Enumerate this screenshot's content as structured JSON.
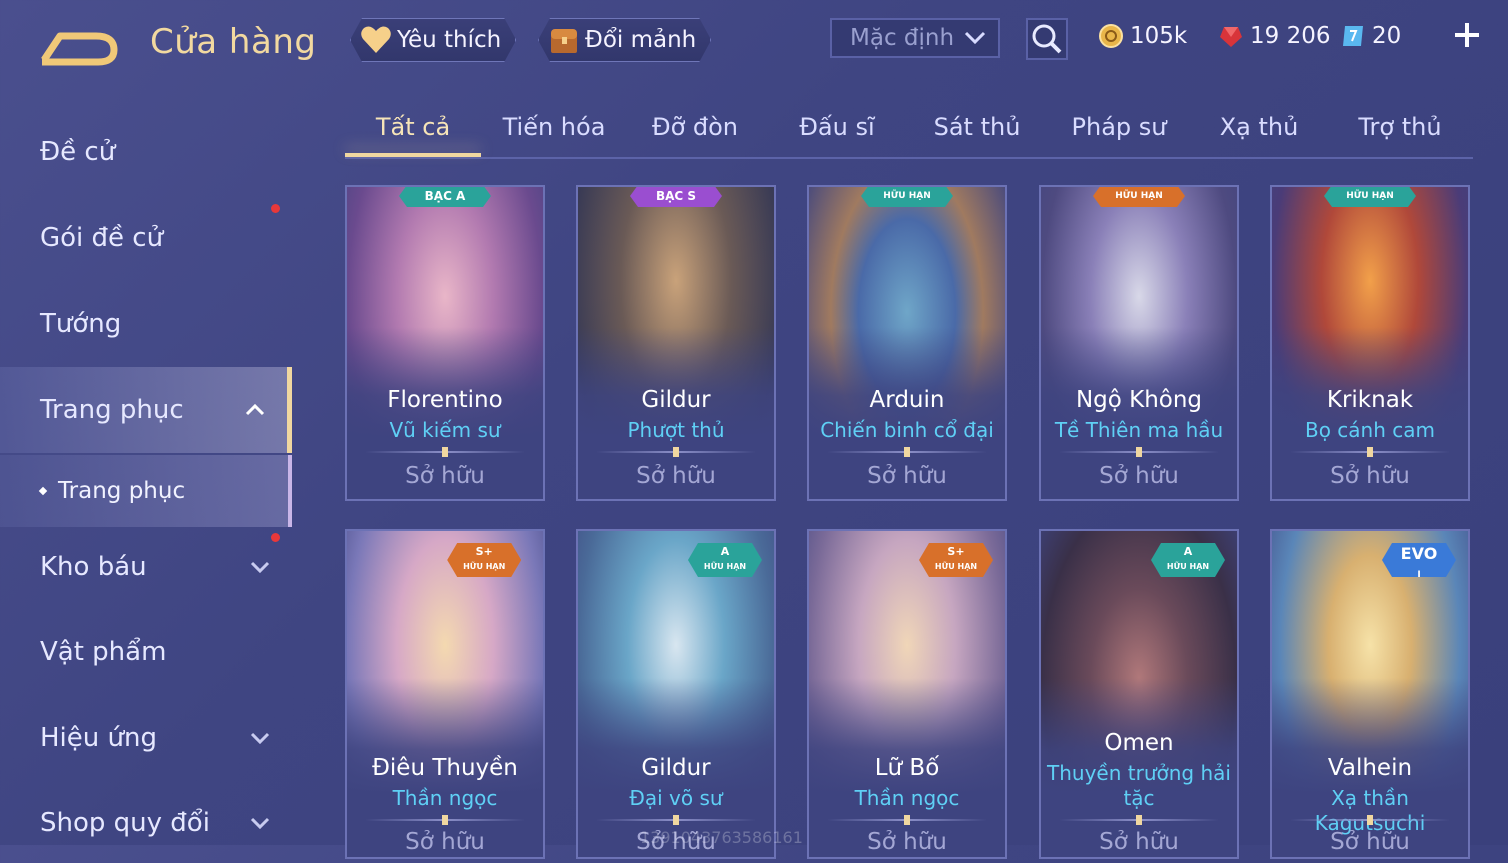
{
  "header": {
    "title": "Cửa hàng",
    "favorites_label": "Yêu thích",
    "exchange_label": "Đổi mảnh",
    "sort_value": "Mặc định",
    "currencies": [
      {
        "icon": "gold-coin-icon",
        "value": "105k"
      },
      {
        "icon": "ruby-gem-icon",
        "value": "19 206"
      },
      {
        "icon": "voucher-icon",
        "value": "20"
      }
    ]
  },
  "sidebar": {
    "items": [
      {
        "label": "Đề cử"
      },
      {
        "label": "Gói đề cử"
      },
      {
        "label": "Tướng"
      },
      {
        "label": "Trang phục"
      },
      {
        "label": "Kho báu"
      },
      {
        "label": "Vật phẩm"
      },
      {
        "label": "Hiệu ứng"
      },
      {
        "label": "Shop quy đổi"
      }
    ],
    "sub_item": "Trang phục"
  },
  "tabs": [
    "Tất cả",
    "Tiến hóa",
    "Đỡ đòn",
    "Đấu sĩ",
    "Sát thủ",
    "Pháp sư",
    "Xạ thủ",
    "Trợ thủ"
  ],
  "cards": [
    {
      "hero": "Florentino",
      "skin": "Vũ kiếm sư",
      "status": "Sở hữu",
      "badge": "BẠC A"
    },
    {
      "hero": "Gildur",
      "skin": "Phượt thủ",
      "status": "Sở hữu",
      "badge": "BẠC S"
    },
    {
      "hero": "Arduin",
      "skin": "Chiến binh cổ đại",
      "status": "Sở hữu",
      "badge": "HỮU HẠN"
    },
    {
      "hero": "Ngộ Không",
      "skin": "Tề Thiên ma hầu",
      "status": "Sở hữu",
      "badge": "HỮU HẠN"
    },
    {
      "hero": "Kriknak",
      "skin": "Bọ cánh cam",
      "status": "Sở hữu",
      "badge": "HỮU HẠN"
    },
    {
      "hero": "Điêu Thuyền",
      "skin": "Thần ngọc",
      "status": "Sở hữu",
      "badge_tier": "S+",
      "badge": "HỮU HẠN"
    },
    {
      "hero": "Gildur",
      "skin": "Đại võ sư",
      "status": "Sở hữu",
      "badge_tier": "A",
      "badge": "HỮU HẠN"
    },
    {
      "hero": "Lữ Bố",
      "skin": "Thần ngọc",
      "status": "Sở hữu",
      "badge_tier": "S+",
      "badge": "HỮU HẠN"
    },
    {
      "hero": "Omen",
      "skin": "Thuyền trưởng hải tặc",
      "status": "Sở hữu",
      "badge_tier": "A",
      "badge": "HỮU HẠN"
    },
    {
      "hero": "Valhein",
      "skin": "Xạ thần Kagutsuchi",
      "status": "Sở hữu",
      "badge_tier": "EVO",
      "badge": "I"
    }
  ],
  "watermark": "1391043763586161",
  "colors": {
    "background": "#3f4582",
    "accent_gold": "#f0d7a0",
    "skin_name": "#5fd0f5",
    "notification": "#e8383a"
  }
}
